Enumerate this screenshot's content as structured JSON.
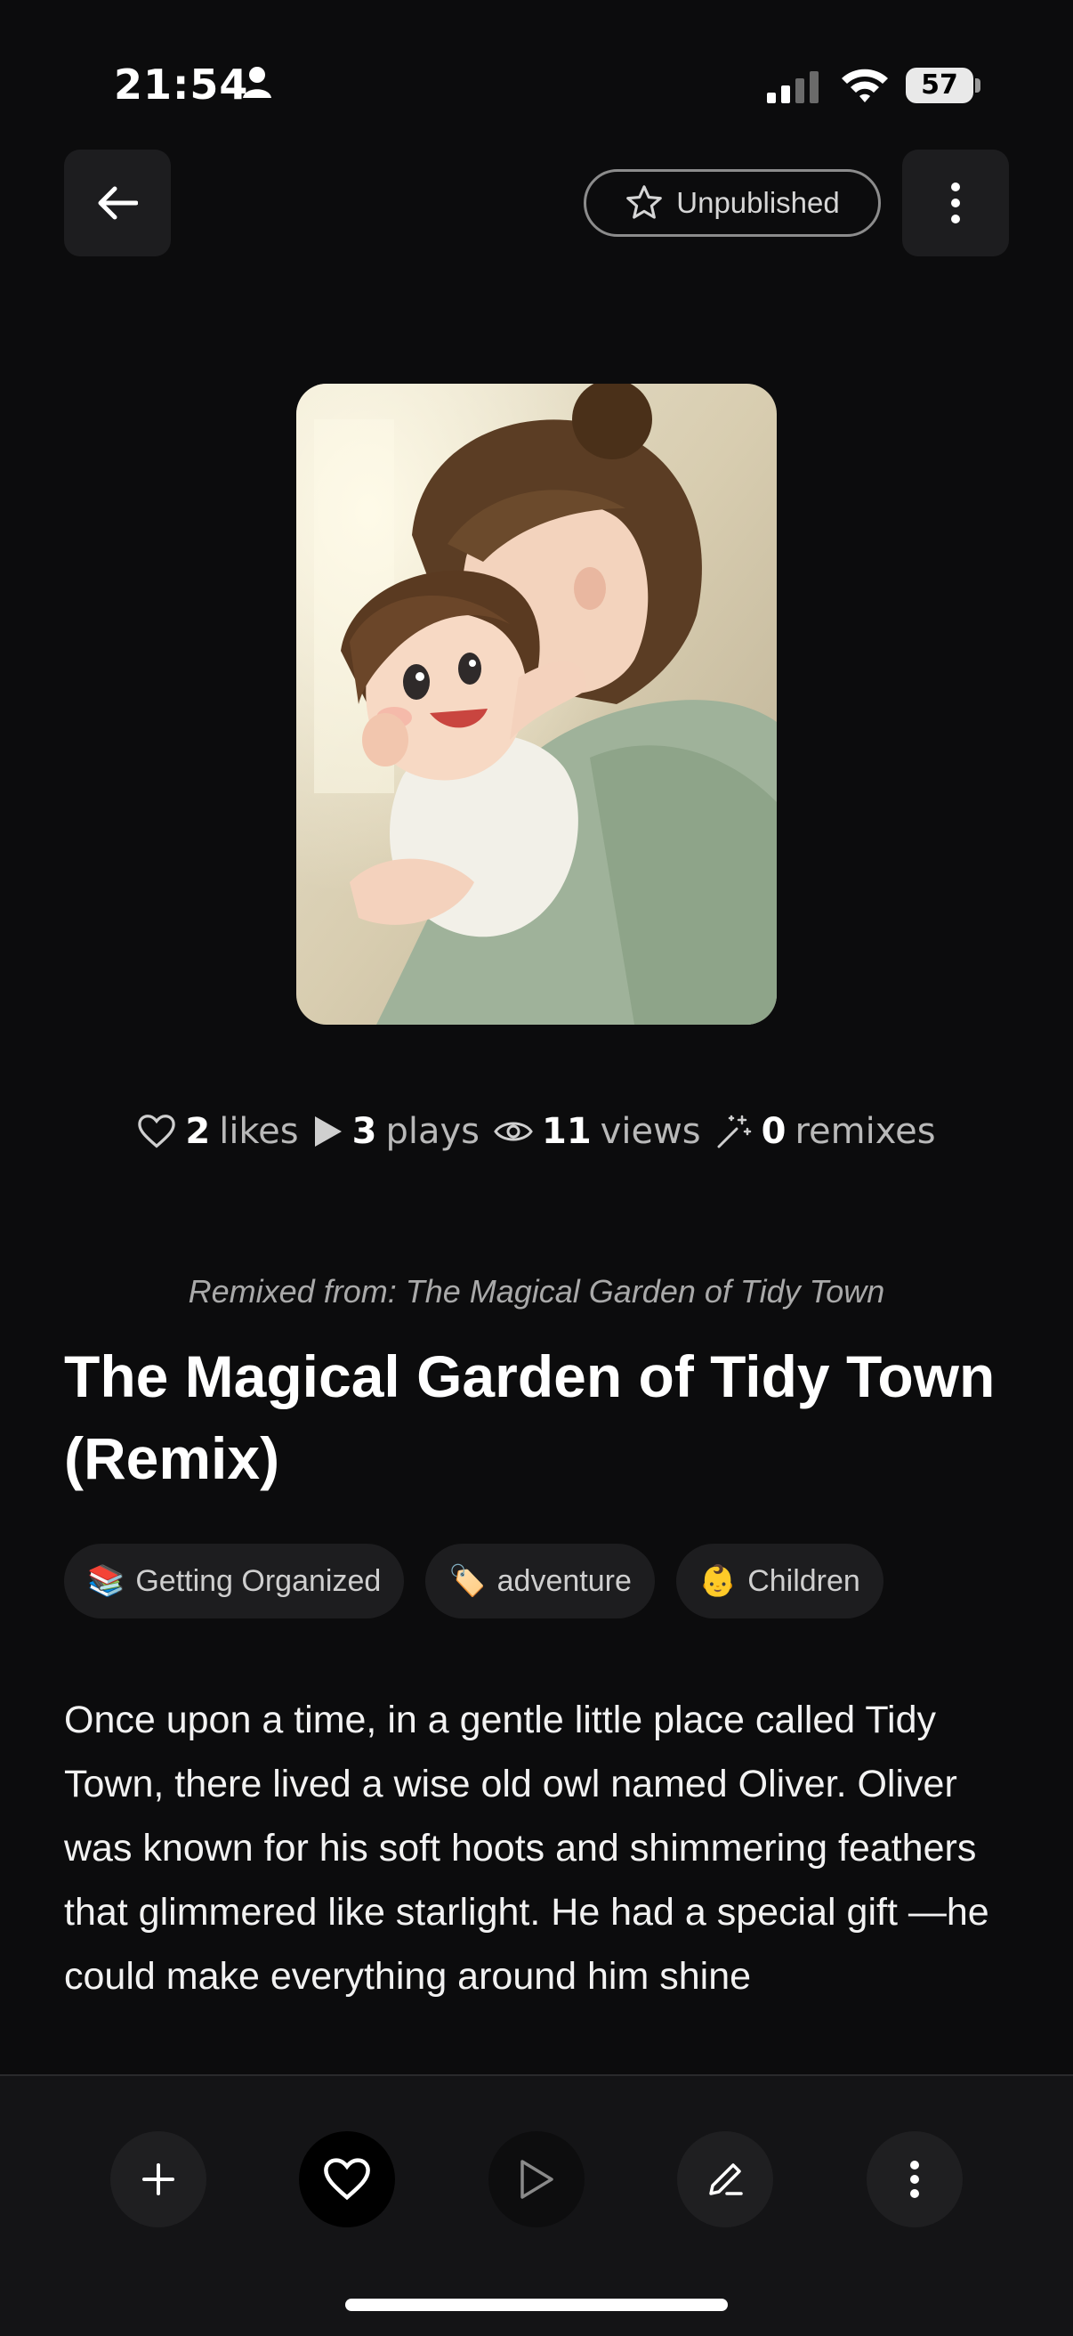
{
  "status_bar": {
    "time": "21:54",
    "battery": "57"
  },
  "header": {
    "publish_status": "Unpublished"
  },
  "stats": [
    {
      "icon": "heart-icon",
      "count": "2",
      "label": "likes"
    },
    {
      "icon": "play-icon",
      "count": "3",
      "label": "plays"
    },
    {
      "icon": "eye-icon",
      "count": "11",
      "label": "views"
    },
    {
      "icon": "sparkle-wand-icon",
      "count": "0",
      "label": "remixes"
    }
  ],
  "story": {
    "remix_source": "Remixed from: The Magical Garden of Tidy Town",
    "title": "The Magical Garden of Tidy Town (Remix)",
    "tags": [
      {
        "emoji": "📚",
        "label": "Getting Organized"
      },
      {
        "emoji": "🏷️",
        "label": "adventure"
      },
      {
        "emoji": "👶",
        "label": "Children"
      }
    ],
    "text": "Once upon a time, in a gentle little place called Tidy Town, there lived a wise old owl named Oliver. Oliver was known for his soft hoots and shimmering feathers that glimmered like starlight. He had a special gift —he could make everything around him shine"
  },
  "colors": {
    "background": "#0c0c0d",
    "surface": "#1d1d1f",
    "text": "#ffffff",
    "muted": "#b9b9b9"
  }
}
